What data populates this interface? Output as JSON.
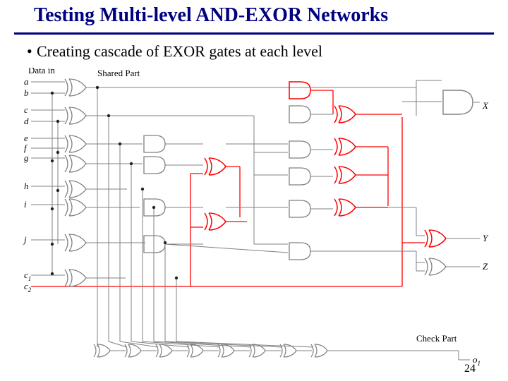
{
  "title": "Testing Multi-level AND-EXOR Networks",
  "bullet": "Creating cascade of EXOR gates at each level",
  "labels": {
    "data_in": "Data in",
    "shared": "Shared Part",
    "check": "Check Part",
    "a": "a",
    "b": "b",
    "c": "c",
    "d": "d",
    "e": "e",
    "f": "f",
    "g": "g",
    "h": "h",
    "i": "i",
    "j": "j",
    "c1": "c",
    "c1s": "1",
    "c2": "c",
    "c2s": "2",
    "X": "X",
    "Y": "Y",
    "Z": "Z",
    "o1": "o",
    "o1s": "1"
  },
  "page": "24",
  "colors": {
    "red": "#ff0000",
    "grey": "#808080",
    "dark": "#232323"
  }
}
